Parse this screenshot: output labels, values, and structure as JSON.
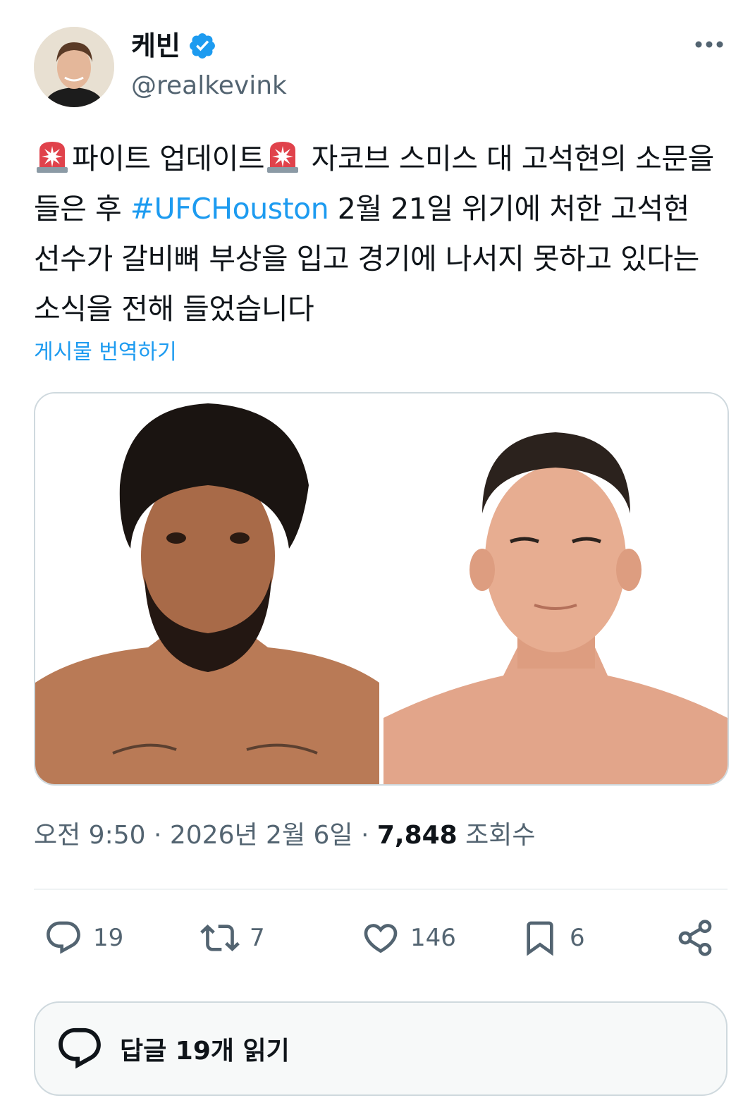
{
  "author": {
    "display_name": "케빈",
    "handle": "@realkevink",
    "verified_icon": "verified-badge-icon",
    "accent": "#1d9bf0"
  },
  "tweet": {
    "line_1_a": "파이트 업데이트",
    "line_1_b": " 자코브 스미스 대 고석현의 소문을 들은 후 ",
    "hashtag": "#UFCHouston",
    "line_rest": " 2월 21일 위기에 처한 고석현 선수가 갈비뼈 부상을 입고 경기에 나서지 못하고 있다는 소식을 전해 들었습니다",
    "siren_icon": "rotating-light-emoji",
    "translate_label": "게시물 번역하기"
  },
  "meta": {
    "time": "오전 9:50 · 2026년 2월 6일 · ",
    "views_count": "7,848",
    "views_label": " 조회수"
  },
  "actions": {
    "replies": "19",
    "retweets": "7",
    "likes": "146",
    "bookmarks": "6"
  },
  "read_replies_label": "답글 19개 읽기"
}
